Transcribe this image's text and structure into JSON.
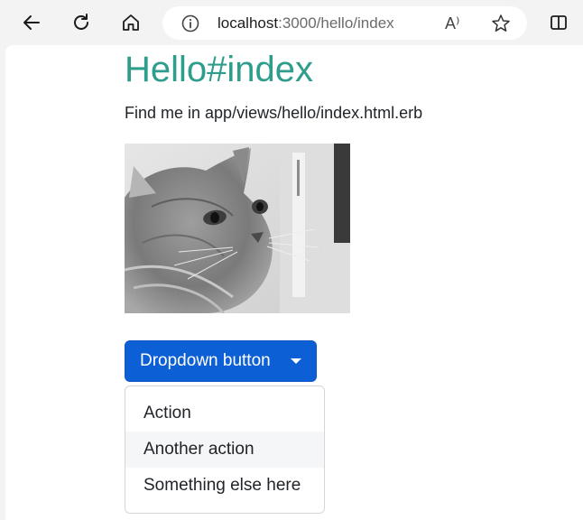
{
  "browser": {
    "url_host": "localhost",
    "url_path": ":3000/hello/index",
    "read_aloud_glyph": "A⁾",
    "icons": [
      "back-arrow-icon",
      "refresh-icon",
      "home-icon",
      "info-icon",
      "read-aloud-icon",
      "favorite-star-icon",
      "split-screen-icon"
    ]
  },
  "page": {
    "title": "Hello#index",
    "description": "Find me in app/views/hello/index.html.erb",
    "image_alt": "cat photo"
  },
  "dropdown": {
    "button_label": "Dropdown button",
    "items": [
      {
        "label": "Action"
      },
      {
        "label": "Another action"
      },
      {
        "label": "Something else here"
      }
    ]
  },
  "colors": {
    "title": "#2e9d8c",
    "button": "#0d5fd6",
    "hovered_item_bg": "#f4f6f8"
  }
}
